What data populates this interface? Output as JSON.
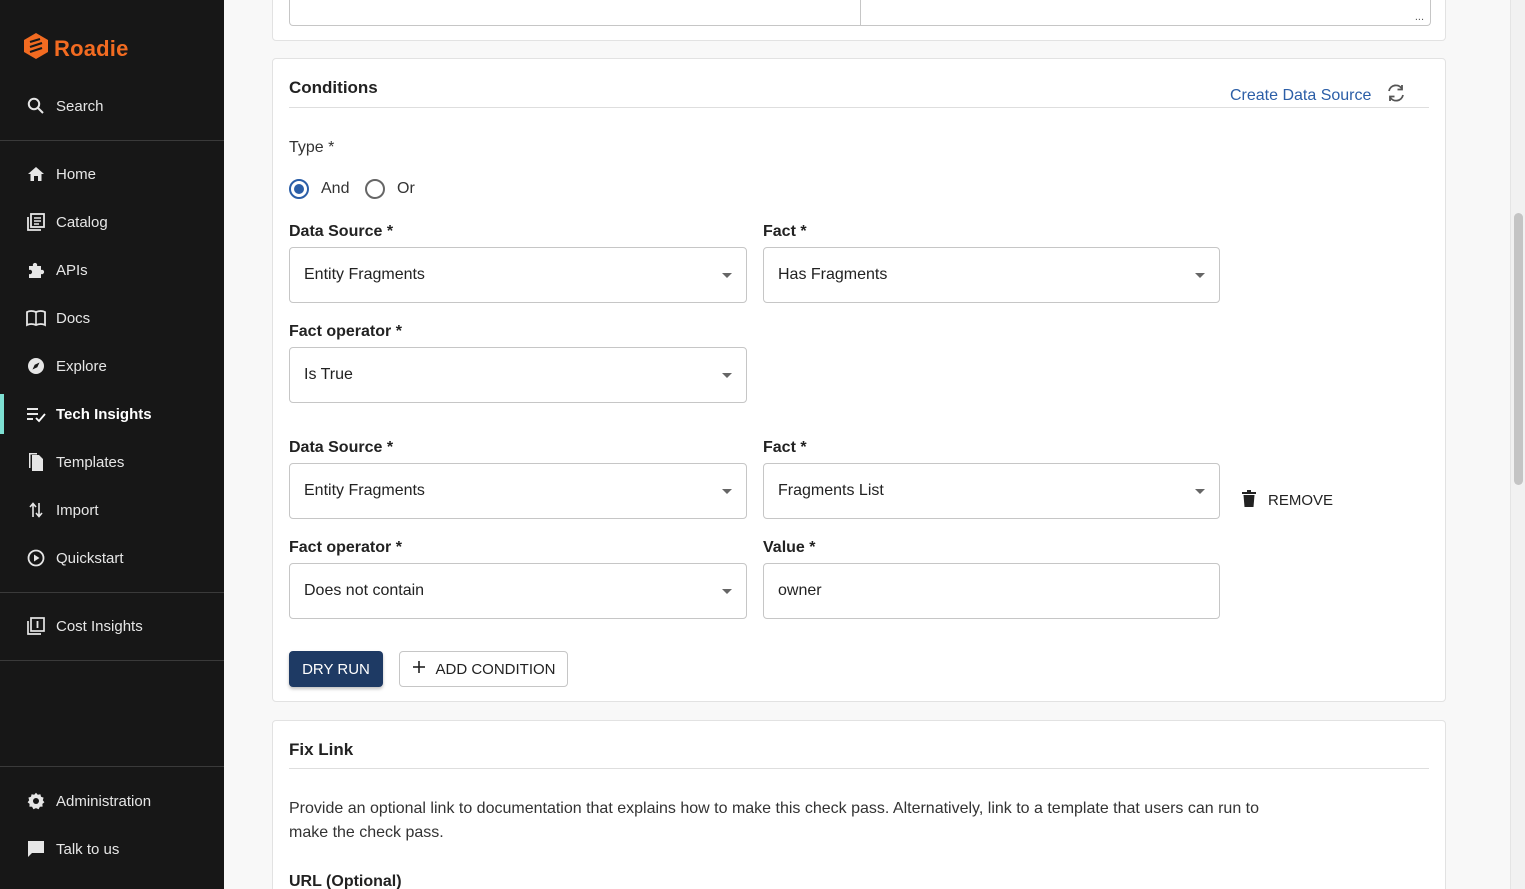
{
  "brand": {
    "name": "Roadie",
    "color": "#f26b21"
  },
  "sidebar": {
    "search": "Search",
    "items": [
      {
        "label": "Home",
        "icon": "home-icon"
      },
      {
        "label": "Catalog",
        "icon": "catalog-icon"
      },
      {
        "label": "APIs",
        "icon": "puzzle-icon"
      },
      {
        "label": "Docs",
        "icon": "book-icon"
      },
      {
        "label": "Explore",
        "icon": "compass-icon"
      },
      {
        "label": "Tech Insights",
        "icon": "checklist-icon",
        "active": true
      },
      {
        "label": "Templates",
        "icon": "templates-icon"
      },
      {
        "label": "Import",
        "icon": "import-icon"
      },
      {
        "label": "Quickstart",
        "icon": "play-icon"
      },
      {
        "label": "Cost Insights",
        "icon": "cost-icon"
      }
    ],
    "bottom": [
      {
        "label": "Administration",
        "icon": "gear-icon"
      },
      {
        "label": "Talk to us",
        "icon": "chat-icon"
      }
    ]
  },
  "conditions": {
    "title": "Conditions",
    "create_data_source": "Create Data Source",
    "type_label": "Type *",
    "type_options": [
      "And",
      "Or"
    ],
    "type_selected": "And",
    "groups": [
      {
        "data_source_label": "Data Source *",
        "data_source_value": "Entity Fragments",
        "fact_label": "Fact *",
        "fact_value": "Has Fragments",
        "operator_label": "Fact operator *",
        "operator_value": "Is True"
      },
      {
        "data_source_label": "Data Source *",
        "data_source_value": "Entity Fragments",
        "fact_label": "Fact *",
        "fact_value": "Fragments List",
        "operator_label": "Fact operator *",
        "operator_value": "Does not contain",
        "value_label": "Value *",
        "value_value": "owner",
        "remove_label": "REMOVE"
      }
    ],
    "dry_run": "DRY RUN",
    "add_condition": "ADD CONDITION"
  },
  "fix_link": {
    "title": "Fix Link",
    "description_line1": "Provide an optional link to documentation that explains how to make this check pass. Alternatively, link to a template that users can run to",
    "description_line2": "make the check pass.",
    "url_label": "URL (Optional)"
  },
  "colors": {
    "accent": "#2b5ea7",
    "primary_button": "#1e3a64",
    "sidebar_bg": "#171717",
    "active_indicator": "#7ee0d3"
  }
}
